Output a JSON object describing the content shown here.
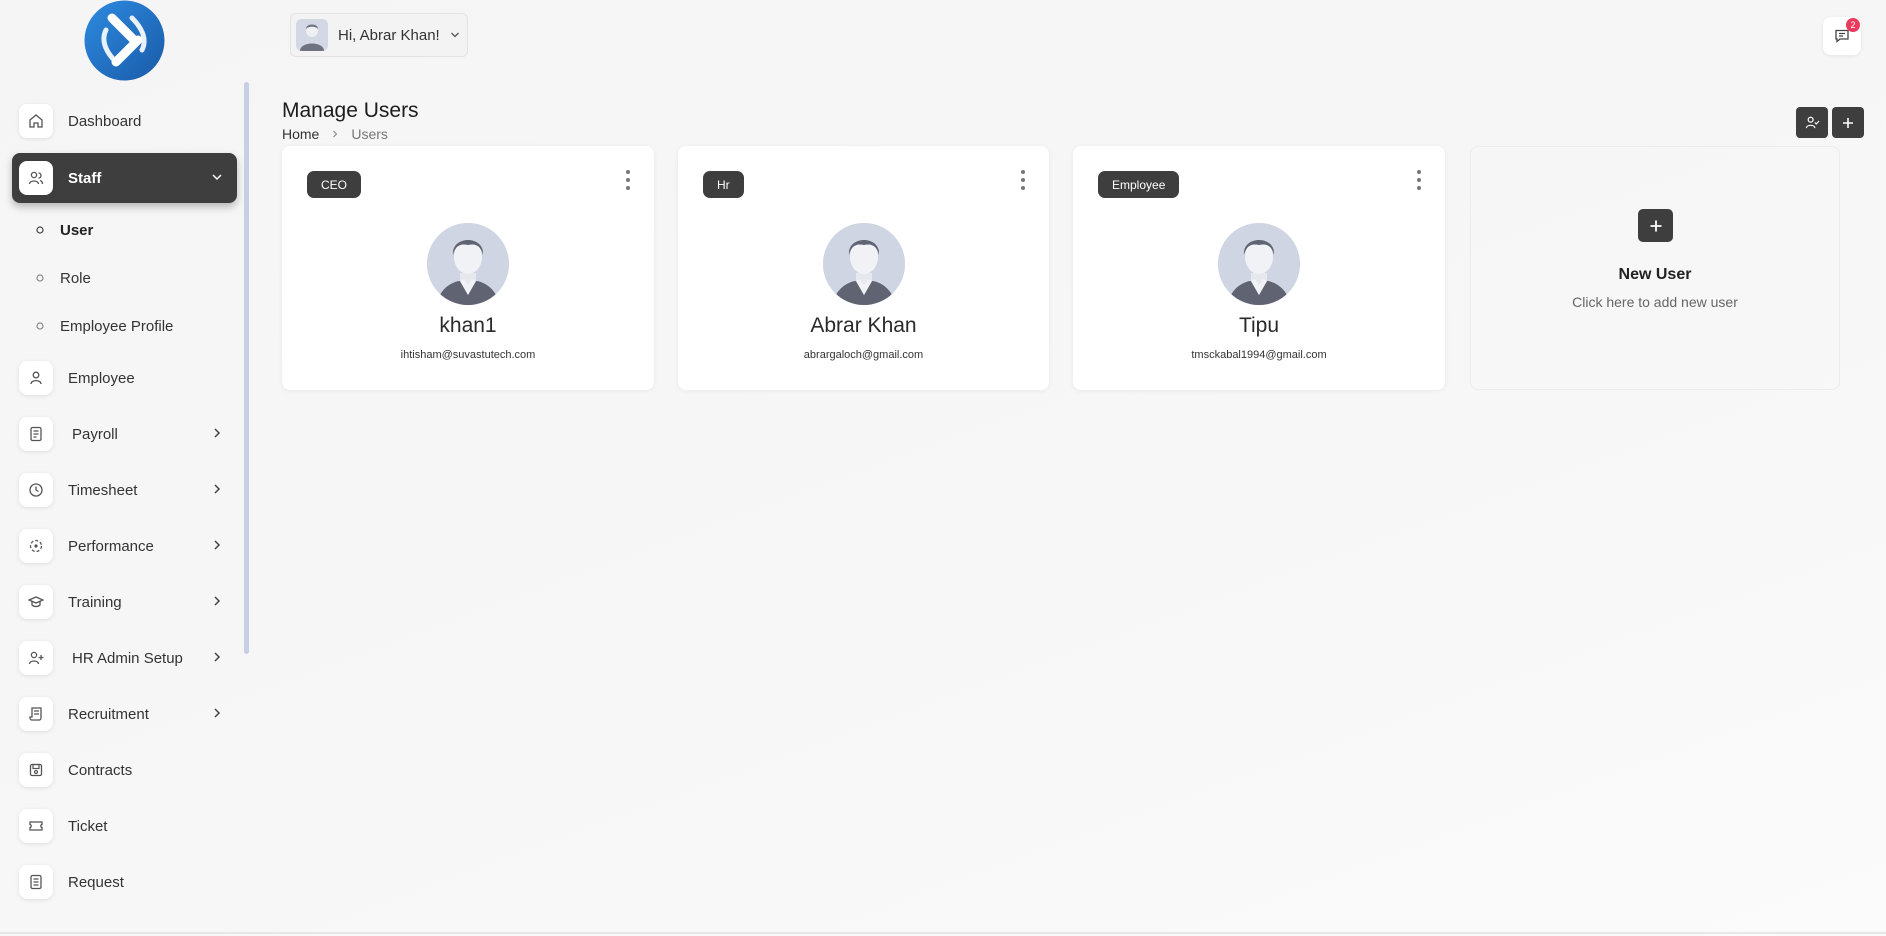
{
  "topbar": {
    "greeting": "Hi, Abrar Khan!",
    "messages_badge": "2"
  },
  "sidebar": {
    "items": [
      {
        "label": "Dashboard",
        "icon": "home-icon"
      },
      {
        "label": "Staff",
        "icon": "users-icon",
        "active": true,
        "expanded": true
      },
      {
        "label": "Employee",
        "icon": "user-icon"
      },
      {
        "label": "Payroll",
        "icon": "receipt-icon"
      },
      {
        "label": "Timesheet",
        "icon": "clock-icon"
      },
      {
        "label": "Performance",
        "icon": "target-icon"
      },
      {
        "label": "Training",
        "icon": "graduation-cap-icon"
      },
      {
        "label": "HR Admin Setup",
        "icon": "user-plus-icon"
      },
      {
        "label": "Recruitment",
        "icon": "scroll-icon"
      },
      {
        "label": "Contracts",
        "icon": "save-icon"
      },
      {
        "label": "Ticket",
        "icon": "ticket-icon"
      },
      {
        "label": "Request",
        "icon": "document-icon"
      }
    ],
    "staff_subitems": [
      {
        "label": "User",
        "active": true
      },
      {
        "label": "Role"
      },
      {
        "label": "Employee Profile"
      }
    ]
  },
  "page": {
    "title": "Manage Users",
    "breadcrumb": {
      "home": "Home",
      "current": "Users"
    }
  },
  "users": [
    {
      "role": "CEO",
      "name": "khan1",
      "email": "ihtisham@suvastutech.com"
    },
    {
      "role": "Hr",
      "name": "Abrar Khan",
      "email": "abrargaloch@gmail.com"
    },
    {
      "role": "Employee",
      "name": "Tipu",
      "email": "tmsckabal1994@gmail.com"
    }
  ],
  "new_user": {
    "title": "New User",
    "subtitle": "Click here to add new user"
  },
  "colors": {
    "accent_dark": "#3e3e3e",
    "badge_red": "#ea3b5c",
    "scrollbar": "#c7cfe6",
    "logo_blue": "#1f6fc4"
  }
}
